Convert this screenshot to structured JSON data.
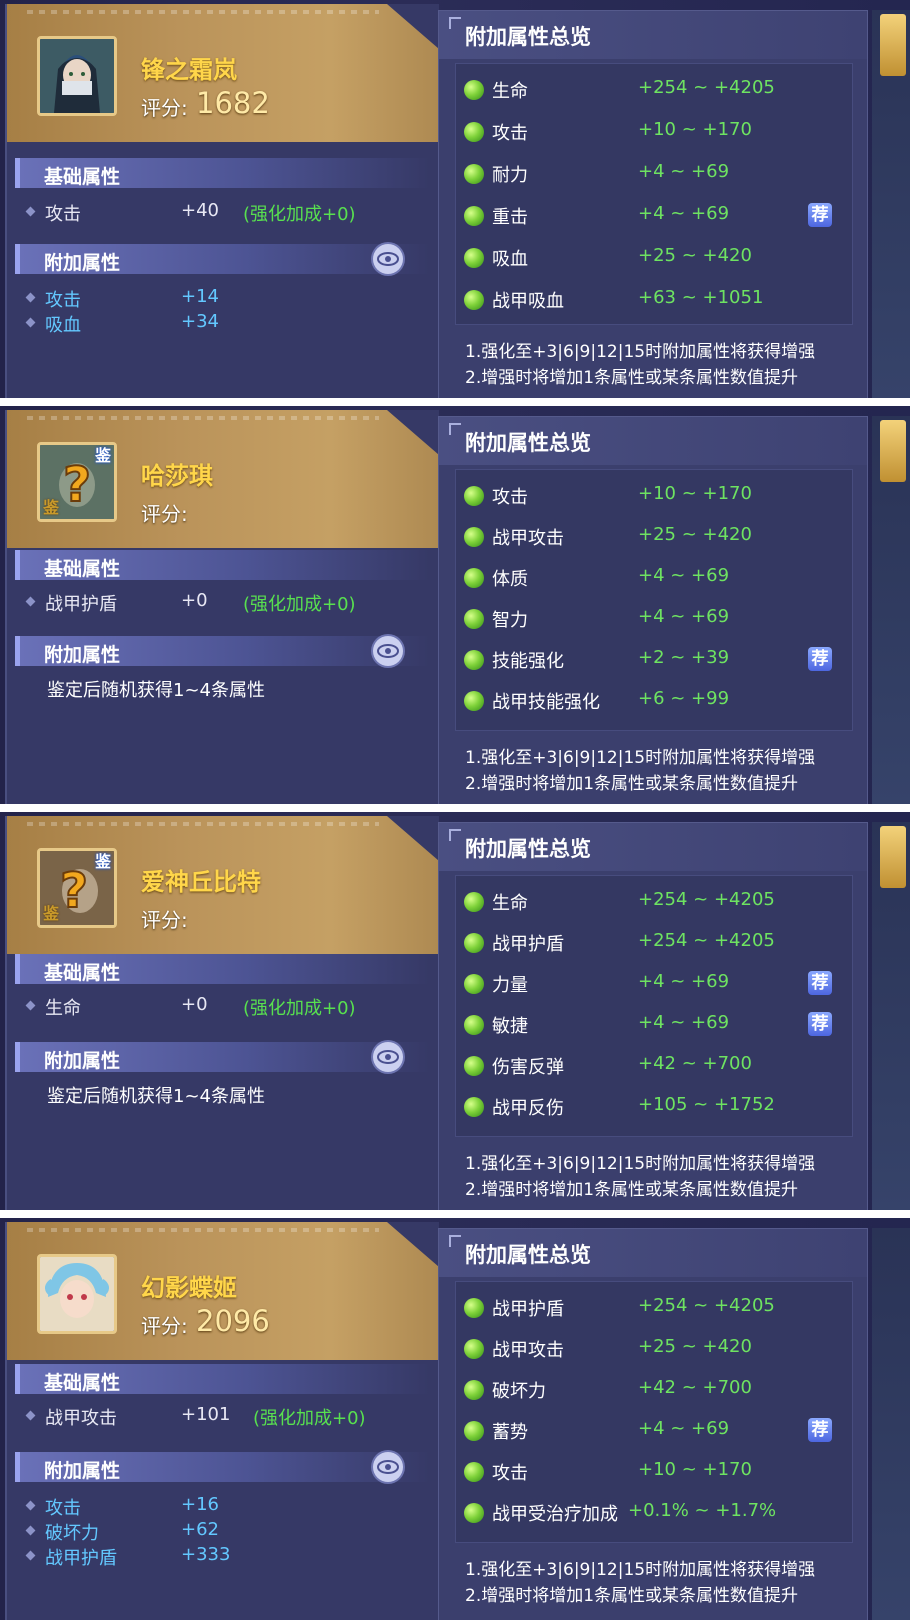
{
  "panels": [
    {
      "card": {
        "name": "锋之霜岚",
        "score_label": "评分:",
        "score": "1682",
        "identify_marks": false,
        "base_section": "基础属性",
        "base_attr": {
          "label": "攻击",
          "value": "+40",
          "bonus": "(强化加成+0)"
        },
        "extra_section": "附加属性",
        "extra_attrs": [
          {
            "label": "攻击",
            "value": "+14"
          },
          {
            "label": "吸血",
            "value": "+34"
          }
        ]
      },
      "overview": {
        "title": "附加属性总览",
        "attrs": [
          {
            "name": "生命",
            "range": "+254 ~ +4205",
            "recommended": false
          },
          {
            "name": "攻击",
            "range": "+10 ~ +170",
            "recommended": false
          },
          {
            "name": "耐力",
            "range": "+4 ~ +69",
            "recommended": false
          },
          {
            "name": "重击",
            "range": "+4 ~ +69",
            "recommended": true
          },
          {
            "name": "吸血",
            "range": "+25 ~ +420",
            "recommended": false
          },
          {
            "name": "战甲吸血",
            "range": "+63 ~ +1051",
            "recommended": false
          }
        ],
        "notes": [
          "1.强化至+3|6|9|12|15时附加属性将获得增强",
          "2.增强时将增加1条属性或某条属性数值提升"
        ]
      }
    },
    {
      "card": {
        "name": "哈莎琪",
        "score_label": "评分:",
        "score": "",
        "identify_marks": true,
        "base_section": "基础属性",
        "base_attr": {
          "label": "战甲护盾",
          "value": "+0",
          "bonus": "(强化加成+0)"
        },
        "extra_section": "附加属性",
        "extra_desc": "鉴定后随机获得1~4条属性"
      },
      "overview": {
        "title": "附加属性总览",
        "attrs": [
          {
            "name": "攻击",
            "range": "+10 ~ +170",
            "recommended": false
          },
          {
            "name": "战甲攻击",
            "range": "+25 ~ +420",
            "recommended": false
          },
          {
            "name": "体质",
            "range": "+4 ~ +69",
            "recommended": false
          },
          {
            "name": "智力",
            "range": "+4 ~ +69",
            "recommended": false
          },
          {
            "name": "技能强化",
            "range": "+2 ~ +39",
            "recommended": true
          },
          {
            "name": "战甲技能强化",
            "range": "+6 ~ +99",
            "recommended": false
          }
        ],
        "notes": [
          "1.强化至+3|6|9|12|15时附加属性将获得增强",
          "2.增强时将增加1条属性或某条属性数值提升"
        ]
      }
    },
    {
      "card": {
        "name": "爱神丘比特",
        "score_label": "评分:",
        "score": "",
        "identify_marks": true,
        "base_section": "基础属性",
        "base_attr": {
          "label": "生命",
          "value": "+0",
          "bonus": "(强化加成+0)"
        },
        "extra_section": "附加属性",
        "extra_desc": "鉴定后随机获得1~4条属性"
      },
      "overview": {
        "title": "附加属性总览",
        "attrs": [
          {
            "name": "生命",
            "range": "+254 ~ +4205",
            "recommended": false
          },
          {
            "name": "战甲护盾",
            "range": "+254 ~ +4205",
            "recommended": false
          },
          {
            "name": "力量",
            "range": "+4 ~ +69",
            "recommended": true
          },
          {
            "name": "敏捷",
            "range": "+4 ~ +69",
            "recommended": true
          },
          {
            "name": "伤害反弹",
            "range": "+42 ~ +700",
            "recommended": false
          },
          {
            "name": "战甲反伤",
            "range": "+105 ~ +1752",
            "recommended": false
          }
        ],
        "notes": [
          "1.强化至+3|6|9|12|15时附加属性将获得增强",
          "2.增强时将增加1条属性或某条属性数值提升"
        ]
      }
    },
    {
      "card": {
        "name": "幻影蝶姬",
        "score_label": "评分:",
        "score": "2096",
        "identify_marks": false,
        "base_section": "基础属性",
        "base_attr": {
          "label": "战甲攻击",
          "value": "+101",
          "bonus": "(强化加成+0)"
        },
        "extra_section": "附加属性",
        "extra_attrs": [
          {
            "label": "攻击",
            "value": "+16"
          },
          {
            "label": "破坏力",
            "value": "+62"
          },
          {
            "label": "战甲护盾",
            "value": "+333"
          }
        ]
      },
      "overview": {
        "title": "附加属性总览",
        "attrs": [
          {
            "name": "战甲护盾",
            "range": "+254 ~ +4205",
            "recommended": false
          },
          {
            "name": "战甲攻击",
            "range": "+25 ~ +420",
            "recommended": false
          },
          {
            "name": "破坏力",
            "range": "+42 ~ +700",
            "recommended": false
          },
          {
            "name": "蓄势",
            "range": "+4 ~ +69",
            "recommended": true
          },
          {
            "name": "攻击",
            "range": "+10 ~ +170",
            "recommended": false
          },
          {
            "name": "战甲受治疗加成",
            "range": "+0.1% ~ +1.7%",
            "recommended": false
          }
        ],
        "notes": [
          "1.强化至+3|6|9|12|15时附加属性将获得增强",
          "2.增强时将增加1条属性或某条属性数值提升"
        ]
      }
    }
  ],
  "recommend_badge": "荐",
  "identify_badge": "鉴",
  "icons": {
    "eye": "eye-icon",
    "attr_dot": "green-orb-icon",
    "unknown_avatar": "question-mark-icon"
  },
  "colors": {
    "name": "#ffd64a",
    "range": "#6ee361",
    "bonus": "#58e04f",
    "extra_value": "#63c8ff",
    "recommend": "#5a72e6"
  }
}
